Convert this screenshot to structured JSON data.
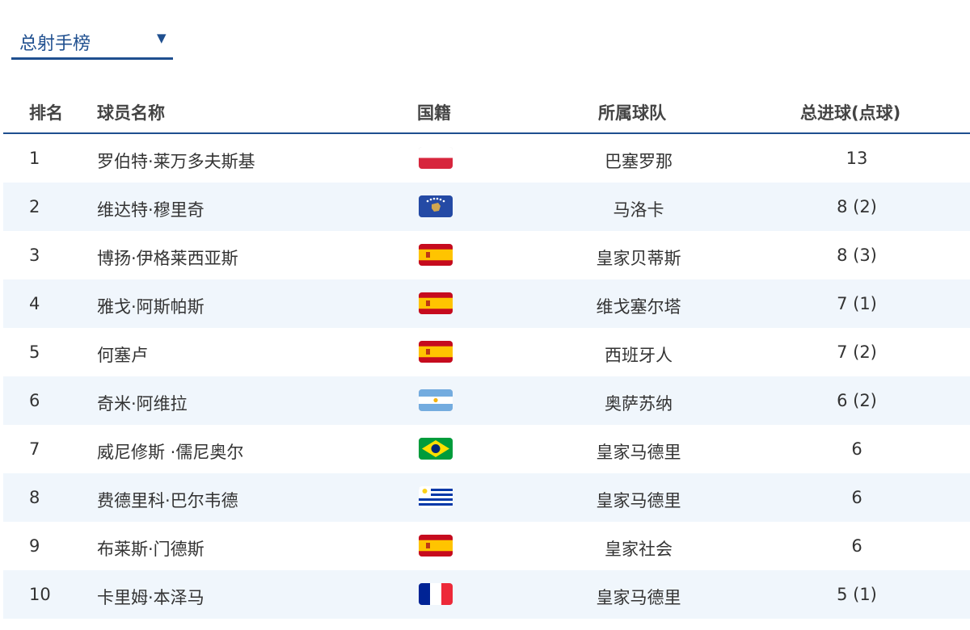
{
  "selector": {
    "label": "总射手榜",
    "arrow": "▼"
  },
  "table": {
    "headers": {
      "rank": "排名",
      "name": "球员名称",
      "nation": "国籍",
      "team": "所属球队",
      "goals": "总进球(点球)"
    },
    "rows": [
      {
        "rank": "1",
        "name": "罗伯特·莱万多夫斯基",
        "flag": "poland-flag-icon",
        "team": "巴塞罗那",
        "goals": "13"
      },
      {
        "rank": "2",
        "name": "维达特·穆里奇",
        "flag": "kosovo-flag-icon",
        "team": "马洛卡",
        "goals": "8 (2)"
      },
      {
        "rank": "3",
        "name": "博扬·伊格莱西亚斯",
        "flag": "spain-flag-icon",
        "team": "皇家贝蒂斯",
        "goals": "8 (3)"
      },
      {
        "rank": "4",
        "name": "雅戈·阿斯帕斯",
        "flag": "spain-flag-icon",
        "team": "维戈塞尔塔",
        "goals": "7 (1)"
      },
      {
        "rank": "5",
        "name": "何塞卢",
        "flag": "spain-flag-icon",
        "team": "西班牙人",
        "goals": "7 (2)"
      },
      {
        "rank": "6",
        "name": "奇米·阿维拉",
        "flag": "argentina-flag-icon",
        "team": "奥萨苏纳",
        "goals": "6 (2)"
      },
      {
        "rank": "7",
        "name": "威尼修斯 ·儒尼奥尔",
        "flag": "brazil-flag-icon",
        "team": "皇家马德里",
        "goals": "6"
      },
      {
        "rank": "8",
        "name": "费德里科·巴尔韦德",
        "flag": "uruguay-flag-icon",
        "team": "皇家马德里",
        "goals": "6"
      },
      {
        "rank": "9",
        "name": "布莱斯·门德斯",
        "flag": "spain-flag-icon",
        "team": "皇家社会",
        "goals": "6"
      },
      {
        "rank": "10",
        "name": "卡里姆·本泽马",
        "flag": "france-flag-icon",
        "team": "皇家马德里",
        "goals": "5 (1)"
      }
    ]
  },
  "colors": {
    "accent": "#1f4f8f",
    "row_alt": "#f0f6fc"
  }
}
